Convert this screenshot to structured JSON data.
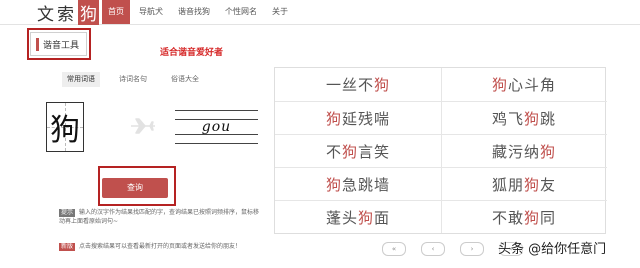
{
  "logo": {
    "text": "文索",
    "accent": "狗"
  },
  "nav": {
    "items": [
      {
        "label": "首页",
        "active": true
      },
      {
        "label": "导航犬",
        "active": false
      },
      {
        "label": "谐音找狗",
        "active": false
      },
      {
        "label": "个性网名",
        "active": false
      },
      {
        "label": "关于",
        "active": false
      }
    ]
  },
  "tool": {
    "title": "谐音工具",
    "slogan": "适合谐音爱好者"
  },
  "tabs": [
    {
      "label": "常用词语",
      "active": true
    },
    {
      "label": "诗词名句",
      "active": false
    },
    {
      "label": "俗语大全",
      "active": false
    }
  ],
  "input_char": "狗",
  "output_pinyin": "gou",
  "query_button": "查询",
  "notes": [
    {
      "tag": "提示",
      "text": "输入的汉字作为结果找匹配的字，查询结果已按照词频排序，鼠标移动再上面看原始词句~"
    },
    {
      "tag": "新版",
      "text": "点击搜索结果可以查看最新打开的页面或者发送给你的朋友！"
    }
  ],
  "results": [
    {
      "pre": "一丝不",
      "hl": "狗",
      "post": ""
    },
    {
      "pre": "",
      "hl": "狗",
      "post": "心斗角"
    },
    {
      "pre": "",
      "hl": "狗",
      "post": "延残喘"
    },
    {
      "pre": "鸡飞",
      "hl": "狗",
      "post": "跳"
    },
    {
      "pre": "不",
      "hl": "狗",
      "post": "言笑"
    },
    {
      "pre": "藏污纳",
      "hl": "狗",
      "post": ""
    },
    {
      "pre": "",
      "hl": "狗",
      "post": "急跳墙"
    },
    {
      "pre": "狐朋",
      "hl": "狗",
      "post": "友"
    },
    {
      "pre": "蓬头",
      "hl": "狗",
      "post": "面"
    },
    {
      "pre": "不敢",
      "hl": "狗",
      "post": "同"
    }
  ],
  "pager": [
    "«",
    "‹",
    "›",
    "»"
  ],
  "watermark": "头条 @给你任意门",
  "colors": {
    "accent": "#c0504d",
    "highlight_outline": "#b52222",
    "slogan": "#d62a2a"
  }
}
